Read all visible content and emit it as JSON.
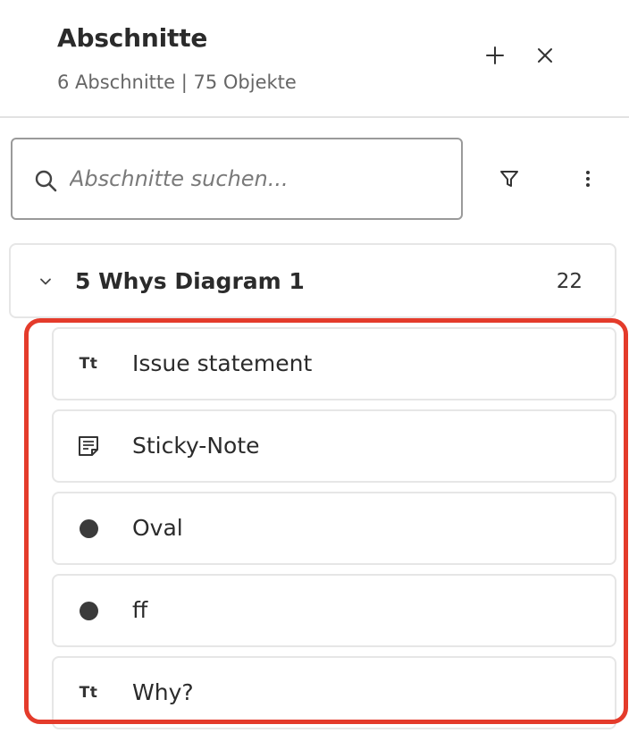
{
  "header": {
    "title": "Abschnitte",
    "subtitle": "6 Abschnitte | 75 Objekte",
    "add_icon": "plus-icon",
    "close_icon": "close-icon"
  },
  "search": {
    "placeholder": "Abschnitte suchen...",
    "value": ""
  },
  "toolbar": {
    "filter_icon": "filter-icon",
    "more_icon": "more-vertical-icon"
  },
  "section": {
    "name": "5 Whys Diagram 1",
    "count": "22",
    "expanded": true
  },
  "items": [
    {
      "label": "Issue statement",
      "icon": "text-icon",
      "icon_text": "Tt"
    },
    {
      "label": "Sticky-Note",
      "icon": "sticky-note-icon"
    },
    {
      "label": "Oval",
      "icon": "circle-shape-icon"
    },
    {
      "label": "ff",
      "icon": "circle-shape-icon"
    },
    {
      "label": "Why?",
      "icon": "text-icon",
      "icon_text": "Tt"
    }
  ],
  "colors": {
    "highlight": "#e43b2b",
    "border": "#e6e6e6",
    "text": "#2b2b2b",
    "muted": "#666666"
  }
}
